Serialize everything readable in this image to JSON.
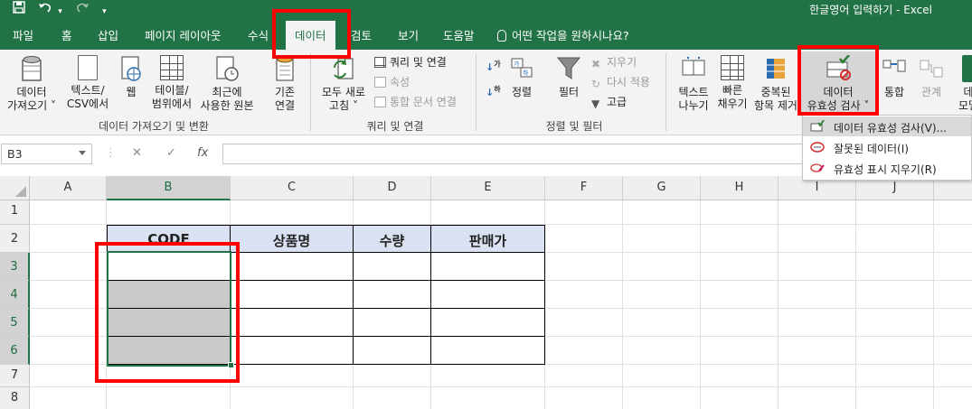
{
  "titlebar": {
    "document": "한글영어 입력하기 - Excel",
    "qat": [
      "save-icon",
      "undo-icon",
      "redo-icon",
      "customize-icon"
    ]
  },
  "tabs": [
    "파일",
    "홈",
    "삽입",
    "페이지 레이아웃",
    "수식",
    "데이터",
    "검토",
    "보기",
    "도움말"
  ],
  "tell_me": "어떤 작업을 원하시나요?",
  "ribbon": {
    "get_data": {
      "line1": "데이터",
      "line2": "가져오기 ˅"
    },
    "text_csv": {
      "line1": "텍스트/",
      "line2": "CSV에서"
    },
    "web": "웹",
    "table_range": {
      "line1": "테이블/",
      "line2": "범위에서"
    },
    "recent": {
      "line1": "최근에",
      "line2": "사용한 원본"
    },
    "existing": {
      "line1": "기존",
      "line2": "연결"
    },
    "group1": "데이터 가져오기 및 변환",
    "refresh_all": {
      "line1": "모두 새로",
      "line2": "고침 ˅"
    },
    "queries": "쿼리 및 연결",
    "properties": "속성",
    "edit_links": "통합 문서 연결",
    "group2": "쿼리 및 연결",
    "sort": "정렬",
    "filter": "필터",
    "clear": "지우기",
    "reapply": "다시 적용",
    "advanced": "고급",
    "group3": "정렬 및 필터",
    "text_to_columns": {
      "line1": "텍스트",
      "line2": "나누기"
    },
    "flash_fill": {
      "line1": "빠른",
      "line2": "채우기"
    },
    "remove_dup": {
      "line1": "중복된",
      "line2": "항목 제거"
    },
    "data_validation": {
      "line1": "데이터",
      "line2": "유효성 검사 ˅"
    },
    "consolidate": "통합",
    "relationships": "관계",
    "data_model": {
      "line1": "데",
      "line2": "모델"
    }
  },
  "menu": {
    "item1": "데이터 유효성 검사(V)...",
    "item2": "잘못된 데이터(I)",
    "item3": "유효성 표시 지우기(R)"
  },
  "formula_bar": {
    "name_box": "B3",
    "cancel": "✕",
    "enter": "✓",
    "fx": "fx",
    "value": ""
  },
  "sheet": {
    "columns": [
      "A",
      "B",
      "C",
      "D",
      "E",
      "F",
      "G",
      "H",
      "I",
      "J"
    ],
    "rows": [
      "1",
      "2",
      "3",
      "4",
      "5",
      "6",
      "7",
      "8"
    ],
    "headers": [
      "CODE",
      "상품명",
      "수량",
      "판매가"
    ]
  },
  "colors": {
    "excel_green": "#217346",
    "header_fill": "#d9e1f2",
    "gray_fill": "#c9c9c9",
    "highlight_red": "#ff0000"
  }
}
